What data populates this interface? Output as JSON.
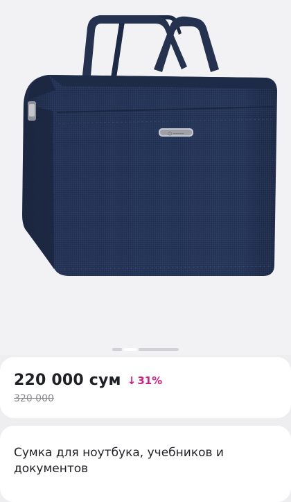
{
  "product": {
    "price": "220 000 сум",
    "discount": "31%",
    "old_price": "320 000",
    "title": "Сумка для ноутбука, учебников и документов"
  },
  "gallery": {
    "image": "navy-laptop-bag",
    "pages_visible": 3,
    "active_page": 2
  },
  "colors": {
    "discount": "#d81b7a",
    "bag": "#27375a",
    "background": "#eeeef1"
  },
  "icons": {
    "discount_arrow": "arrow-down-icon"
  }
}
